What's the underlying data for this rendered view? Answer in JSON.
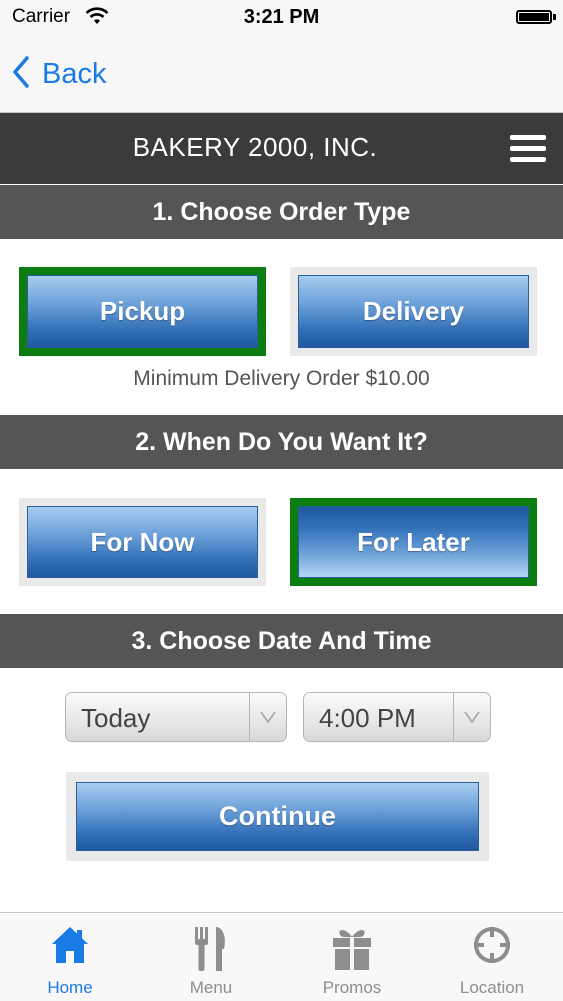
{
  "status_bar": {
    "carrier": "Carrier",
    "time": "3:21 PM"
  },
  "nav": {
    "back_label": "Back"
  },
  "header": {
    "title": "BAKERY 2000, INC."
  },
  "sections": {
    "order_type": {
      "heading": "1. Choose Order Type",
      "options": [
        "Pickup",
        "Delivery"
      ],
      "selected": "Pickup",
      "note": "Minimum Delivery Order $10.00"
    },
    "when": {
      "heading": "2. When Do You Want It?",
      "options": [
        "For Now",
        "For Later"
      ],
      "selected": "For Later"
    },
    "date_time": {
      "heading": "3. Choose Date And Time",
      "date_value": "Today",
      "time_value": "4:00 PM"
    }
  },
  "continue_label": "Continue",
  "tabbar": {
    "items": [
      {
        "label": "Home",
        "icon": "house-icon",
        "active": true
      },
      {
        "label": "Menu",
        "icon": "fork-knife-icon",
        "active": false
      },
      {
        "label": "Promos",
        "icon": "gift-icon",
        "active": false
      },
      {
        "label": "Location",
        "icon": "crosshair-icon",
        "active": false
      }
    ]
  },
  "colors": {
    "accent": "#1a7ae6",
    "selected_border": "#0b7d11",
    "header_bg": "#3b3b3b",
    "section_bg": "#555556"
  }
}
